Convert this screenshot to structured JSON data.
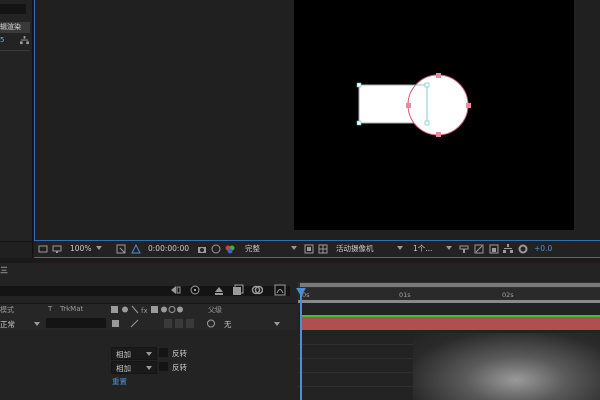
{
  "project": {
    "row_label": "辨合成」合成缓慢预览过滤器",
    "row_label_visible": "辑渲染",
    "row_bit_depth": "5"
  },
  "viewer_toolbar": {
    "zoom": "100%",
    "timecode": "0:00:00:00",
    "resolution": "完整",
    "camera": "活动摄像机",
    "views": "1个...",
    "exposure": "+0.0"
  },
  "timeline": {
    "panel_label": "三",
    "columns": {
      "mode": "模式",
      "t": "T",
      "trkmat": "TrkMat",
      "parent": "父级"
    },
    "layer": {
      "mode": "正常",
      "parent": "无"
    },
    "sub_rows": [
      {
        "mode": "相加",
        "invert": "反转"
      },
      {
        "mode": "相加",
        "invert": "反转"
      }
    ],
    "reset": "重置",
    "ruler": {
      "t0": "0s",
      "t1": "01s",
      "t2": "02s"
    }
  },
  "colors": {
    "accent": "#4a90d9",
    "layer_bar": "#b04f4f",
    "shape_stroke": "#d05c7a",
    "shape_fill": "#ffffff"
  },
  "icons": [
    "tree-icon",
    "camera-icon",
    "color-icon",
    "zoom-icon",
    "region-icon",
    "snapshot-icon",
    "grid-icon",
    "gear-icon",
    "layer-icons"
  ]
}
